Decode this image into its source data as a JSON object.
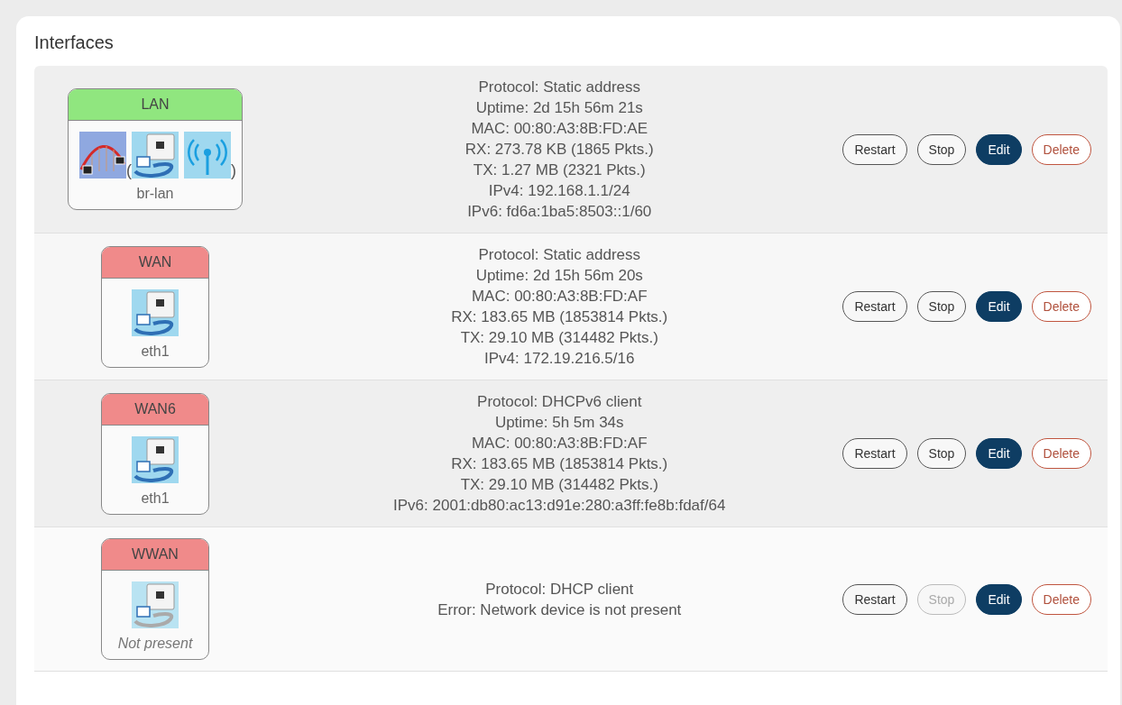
{
  "section": {
    "title": "Interfaces"
  },
  "interfaces": [
    {
      "name": "LAN",
      "color": "#90e67f",
      "devices": [
        {
          "kind": "bridge"
        },
        {
          "kind": "paren",
          "text": "("
        },
        {
          "kind": "ethernet"
        },
        {
          "kind": "wifi"
        },
        {
          "kind": "paren",
          "text": ")"
        }
      ],
      "device_label": "br-lan",
      "present": true,
      "details": [
        "Protocol: Static address",
        "Uptime: 2d 15h 56m 21s",
        "MAC: 00:80:A3:8B:FD:AE",
        "RX: 273.78 KB (1865 Pkts.)",
        "TX: 1.27 MB (2321 Pkts.)",
        "IPv4: 192.168.1.1/24",
        "IPv6: fd6a:1ba5:8503::1/60"
      ],
      "buttons": [
        {
          "kind": "plain",
          "label": "Restart",
          "disabled": false
        },
        {
          "kind": "plain",
          "label": "Stop",
          "disabled": false
        },
        {
          "kind": "primary",
          "label": "Edit",
          "disabled": false
        },
        {
          "kind": "danger",
          "label": "Delete",
          "disabled": false
        }
      ]
    },
    {
      "name": "WAN",
      "color": "#f08a8a",
      "devices": [
        {
          "kind": "ethernet"
        }
      ],
      "device_label": "eth1",
      "present": true,
      "details": [
        "Protocol: Static address",
        "Uptime: 2d 15h 56m 20s",
        "MAC: 00:80:A3:8B:FD:AF",
        "RX: 183.65 MB (1853814 Pkts.)",
        "TX: 29.10 MB (314482 Pkts.)",
        "IPv4: 172.19.216.5/16"
      ],
      "buttons": [
        {
          "kind": "plain",
          "label": "Restart",
          "disabled": false
        },
        {
          "kind": "plain",
          "label": "Stop",
          "disabled": false
        },
        {
          "kind": "primary",
          "label": "Edit",
          "disabled": false
        },
        {
          "kind": "danger",
          "label": "Delete",
          "disabled": false
        }
      ]
    },
    {
      "name": "WAN6",
      "color": "#f08a8a",
      "devices": [
        {
          "kind": "ethernet"
        }
      ],
      "device_label": "eth1",
      "present": true,
      "details": [
        "Protocol: DHCPv6 client",
        "Uptime: 5h 5m 34s",
        "MAC: 00:80:A3:8B:FD:AF",
        "RX: 183.65 MB (1853814 Pkts.)",
        "TX: 29.10 MB (314482 Pkts.)",
        "IPv6: 2001:db80:ac13:d91e:280:a3ff:fe8b:fdaf/64"
      ],
      "buttons": [
        {
          "kind": "plain",
          "label": "Restart",
          "disabled": false
        },
        {
          "kind": "plain",
          "label": "Stop",
          "disabled": false
        },
        {
          "kind": "primary",
          "label": "Edit",
          "disabled": false
        },
        {
          "kind": "danger",
          "label": "Delete",
          "disabled": false
        }
      ]
    },
    {
      "name": "WWAN",
      "color": "#f08a8a",
      "devices": [
        {
          "kind": "ethernet"
        }
      ],
      "device_label": "Not present",
      "present": false,
      "details": [
        "Protocol: DHCP client",
        "Error: Network device is not present"
      ],
      "buttons": [
        {
          "kind": "plain",
          "label": "Restart",
          "disabled": false
        },
        {
          "kind": "plain",
          "label": "Stop",
          "disabled": true
        },
        {
          "kind": "primary",
          "label": "Edit",
          "disabled": false
        },
        {
          "kind": "danger",
          "label": "Delete",
          "disabled": false
        }
      ]
    }
  ]
}
